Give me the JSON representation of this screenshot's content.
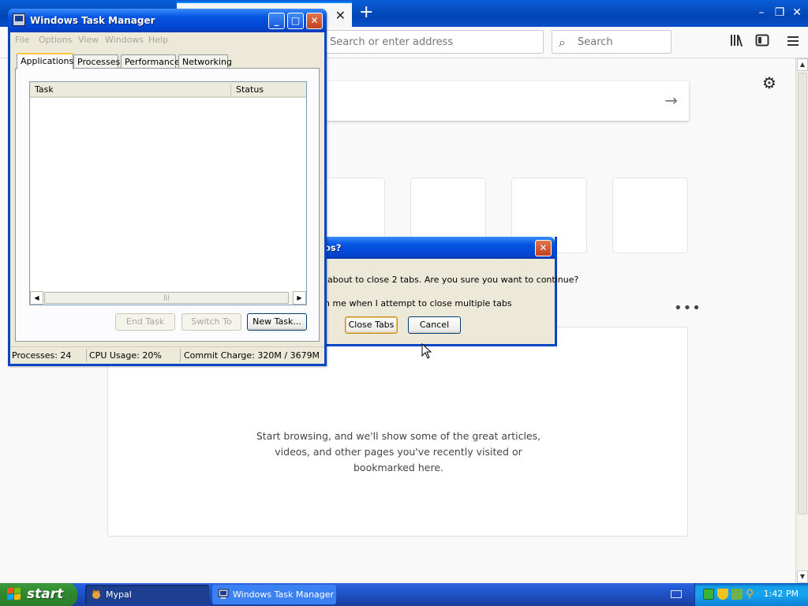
{
  "browser": {
    "tab_close": "✕",
    "new_tab": "+",
    "window_buttons": [
      "–",
      "❐",
      "✕"
    ],
    "url_placeholder": "Search or enter address",
    "search_placeholder": "Search",
    "highlights_message": [
      "Start browsing, and we'll show some of the great articles,",
      "videos, and other pages you've recently visited or",
      "bookmarked here."
    ],
    "more_label": "•••"
  },
  "task_manager": {
    "title": "Windows Task Manager",
    "menu": [
      "File",
      "Options",
      "View",
      "Windows",
      "Help"
    ],
    "tabs": [
      "Applications",
      "Processes",
      "Performance",
      "Networking"
    ],
    "active_tab": "Applications",
    "columns": [
      "Task",
      "Status"
    ],
    "buttons": {
      "end_task": "End Task",
      "switch_to": "Switch To",
      "new_task": "New Task..."
    },
    "status": {
      "processes": "Processes: 24",
      "cpu": "CPU Usage: 20%",
      "commit": "Commit Charge: 320M / 3679M"
    }
  },
  "dialog": {
    "title": "os?",
    "message": "about to close 2 tabs. Are you sure you want to continue?",
    "checkbox_label": "n me when I attempt to close multiple tabs",
    "confirm_label": "Close Tabs",
    "cancel_label": "Cancel"
  },
  "taskbar": {
    "start_label": "start",
    "tasks": [
      "Mypal",
      "Windows Task Manager"
    ],
    "clock": "1:42 PM"
  },
  "colors": {
    "xp_blue": "#0454e2",
    "start_green": "#2f8a2f",
    "accent": "#0a84ff"
  }
}
